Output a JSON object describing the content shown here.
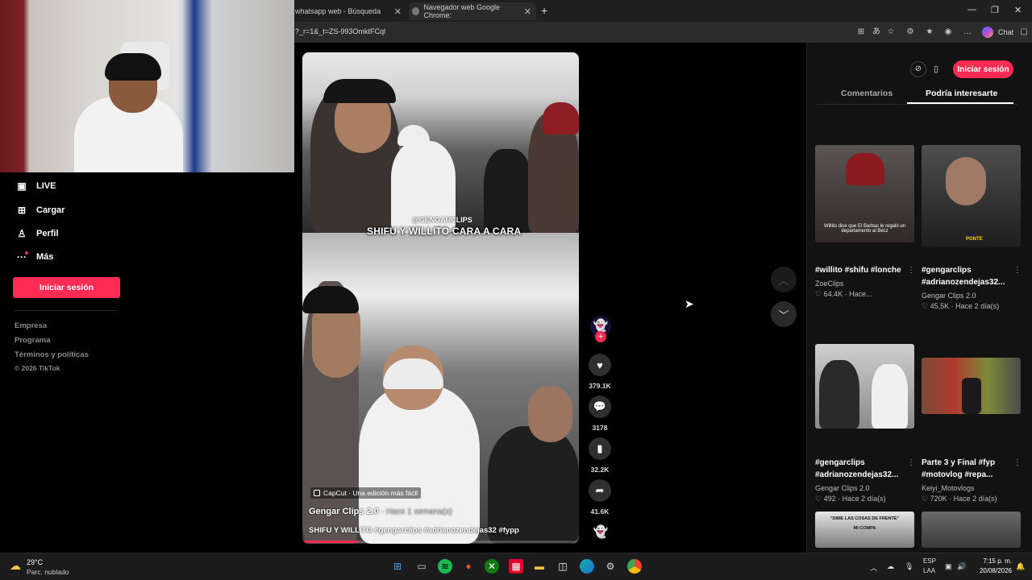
{
  "browser": {
    "tabs": [
      {
        "label": "whatsapp web - Búsqueda"
      },
      {
        "label": "Navegador web Google Chrome:"
      }
    ],
    "url": "?_r=1&_t=ZS-993OmktFCql",
    "chat_label": "Chat"
  },
  "sidebar": {
    "items": [
      {
        "label": "LIVE",
        "icon": "live-icon"
      },
      {
        "label": "Cargar",
        "icon": "upload-icon"
      },
      {
        "label": "Perfil",
        "icon": "profile-icon"
      },
      {
        "label": "Más",
        "icon": "more-icon"
      }
    ],
    "login_label": "Iniciar sesión",
    "footer": [
      "Empresa",
      "Programa",
      "Términos y políticas",
      "© 2026 TikTok"
    ]
  },
  "video": {
    "watermark": "@GENGARCLIPS",
    "caption_overlay": "SHIFU Y WILLITO CARA A CARA",
    "capcut_badge": "CapCut · Una edición más fácil",
    "author": "Gengar Clips 2.0",
    "time": "· Hace 1 semana(s)",
    "description": "SHIFU Y WILLITO #gengarclips #adrianozendejas32 #fypp",
    "progress_percent": 20
  },
  "actions": {
    "likes": "379.1K",
    "comments": "3178",
    "saves": "32.2K",
    "shares": "41.6K"
  },
  "right_panel": {
    "login_label": "Iniciar sesión",
    "tabs": [
      "Comentarios",
      "Podría interesarte"
    ],
    "recommendations": [
      {
        "title": "#willito #shifu #lonche",
        "author": "ZoeClips",
        "likes": "64.4K",
        "time": "· Hace...",
        "thumb_caption": "Willito dice que El Barbas le regaló un departamento al Bécz"
      },
      {
        "title": "#gengarclips #adrianozendejas32...",
        "author": "Gengar Clips 2.0",
        "likes": "45.5K",
        "time": "· Hace 2 día(s)",
        "thumb_caption": "PONTE"
      },
      {
        "title": "#gengarclips #adrianozendejas32...",
        "author": "Gengar Clips 2.0",
        "likes": "492",
        "time": "· Hace 2 día(s)",
        "thumb_caption": ""
      },
      {
        "title": "Parte 3 y Final #fyp #motovlog #repa...",
        "author": "Keiyi_Motovlogs",
        "likes": "720K",
        "time": "· Hace 2 día(s)",
        "thumb_caption": ""
      },
      {
        "title": "",
        "author": "",
        "likes": "",
        "time": "",
        "thumb_caption": "\"DIME LAS COSAS DE FRENTE\" MI COMPA"
      }
    ]
  },
  "taskbar": {
    "weather_temp": "29°C",
    "weather_desc": "Parc. nublado",
    "lang_1": "ESP",
    "lang_2": "LAA",
    "time": "7:15 p. m.",
    "date": "20/08/2026"
  }
}
